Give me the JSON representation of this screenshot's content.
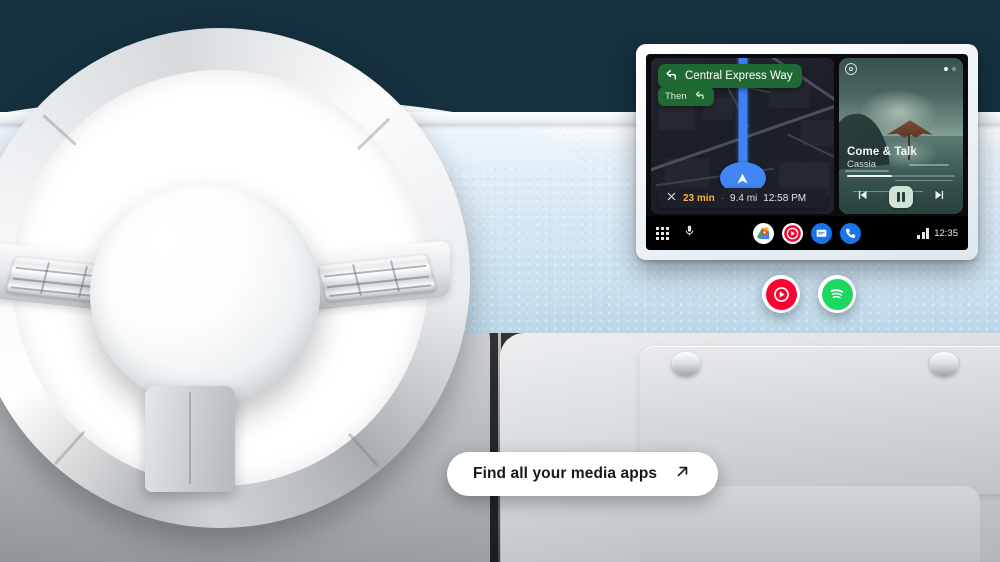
{
  "scene": {
    "title": "Android Auto car dashboard with head unit display",
    "background_color": "#16303f"
  },
  "head_unit": {
    "navigation": {
      "maneuver_icon": "turn-left-icon",
      "street": "Central Express Way",
      "then_label": "Then",
      "then_maneuver_icon": "turn-left-icon",
      "close_icon": "close-icon",
      "eta": {
        "duration": "23 min",
        "separator1": "·",
        "distance": "9.4 mi",
        "separator2": "·",
        "arrival": "12:58 PM",
        "duration_color": "#f5b63a"
      }
    },
    "media": {
      "app_badge_icon": "media-app-icon",
      "track_title": "Come & Talk",
      "artist": "Cassia",
      "prev_icon": "skip-previous-icon",
      "play_pause_icon": "pause-icon",
      "next_icon": "skip-next-icon",
      "page_dots": 2
    },
    "taskbar": {
      "apps_grid_icon": "apps-grid-icon",
      "mic_icon": "microphone-icon",
      "apps": [
        {
          "name": "maps-icon",
          "label": "Google Maps",
          "color": "#ffffff"
        },
        {
          "name": "youtube-music-icon",
          "label": "YouTube Music",
          "color": "#ff0033"
        },
        {
          "name": "messages-icon",
          "label": "Messages",
          "color": "#1a73e8"
        },
        {
          "name": "phone-icon",
          "label": "Phone",
          "color": "#1a73e8"
        }
      ],
      "signal_icon": "cellular-signal-icon",
      "clock": "12:35"
    }
  },
  "floating_apps": [
    {
      "name": "youtube-music-icon",
      "label": "YouTube Music",
      "color": "#ff0033"
    },
    {
      "name": "spotify-icon",
      "label": "Spotify",
      "color": "#1ed760"
    }
  ],
  "cta": {
    "label": "Find all your media apps",
    "icon": "arrow-up-right-icon"
  }
}
